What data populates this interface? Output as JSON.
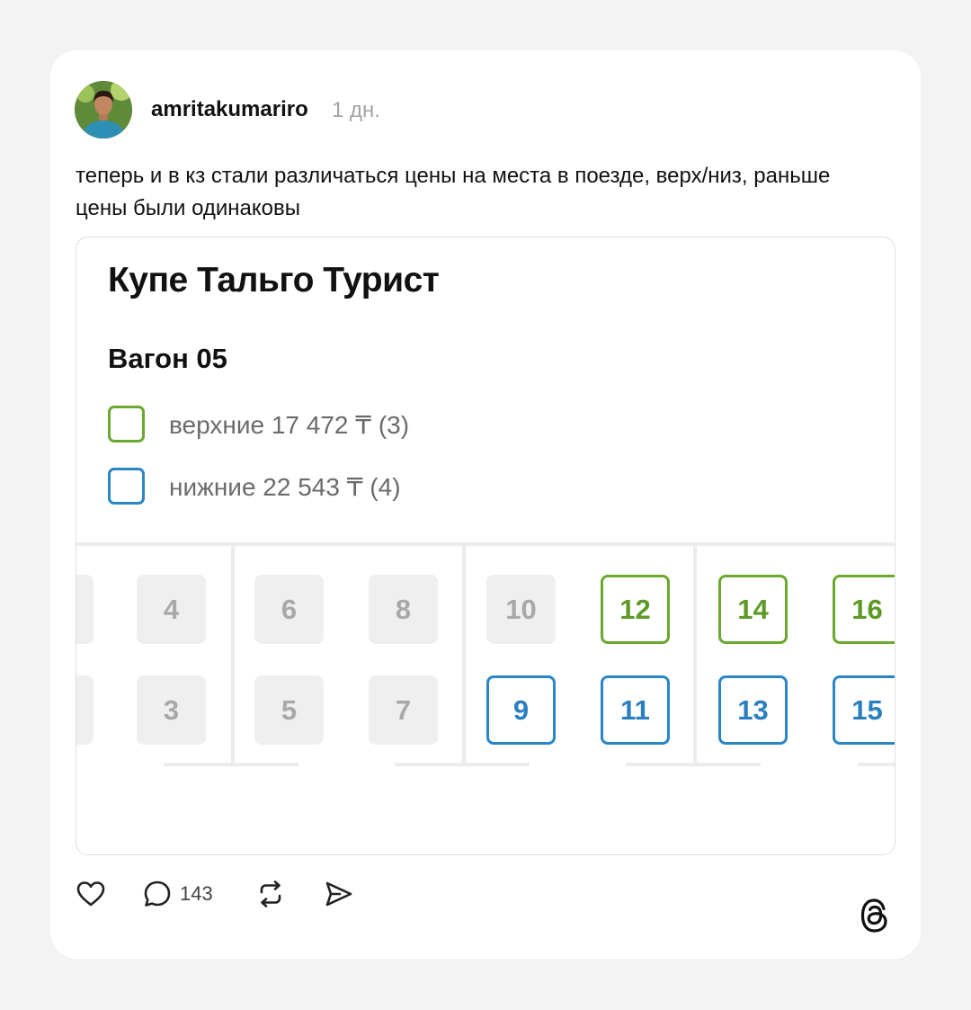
{
  "post": {
    "username": "amritakumariro",
    "time": "1 дн.",
    "text": "теперь и в кз стали различаться цены на места в поезде, верх/низ, раньше цены были одинаковы"
  },
  "screenshot": {
    "title": "Купе Тальго Турист",
    "car": "Вагон 05",
    "legend": [
      {
        "kind": "upper",
        "label": "верхние 17 472 ₸ (3)",
        "color": "#6aa92e"
      },
      {
        "kind": "lower",
        "label": "нижние 22 543 ₸ (4)",
        "color": "#2a87c6"
      }
    ],
    "seats": [
      {
        "number": "4",
        "status": "taken"
      },
      {
        "number": "3",
        "status": "taken"
      },
      {
        "number": "6",
        "status": "taken"
      },
      {
        "number": "8",
        "status": "taken"
      },
      {
        "number": "5",
        "status": "taken"
      },
      {
        "number": "7",
        "status": "taken"
      },
      {
        "number": "10",
        "status": "taken"
      },
      {
        "number": "12",
        "status": "upper"
      },
      {
        "number": "9",
        "status": "lower"
      },
      {
        "number": "11",
        "status": "lower"
      },
      {
        "number": "14",
        "status": "upper"
      },
      {
        "number": "16",
        "status": "upper"
      },
      {
        "number": "13",
        "status": "lower"
      },
      {
        "number": "15",
        "status": "lower"
      }
    ]
  },
  "actions": {
    "replies_count": "143"
  },
  "icons": [
    "heart-icon",
    "comment-icon",
    "repost-icon",
    "share-icon",
    "threads-logo-icon"
  ]
}
